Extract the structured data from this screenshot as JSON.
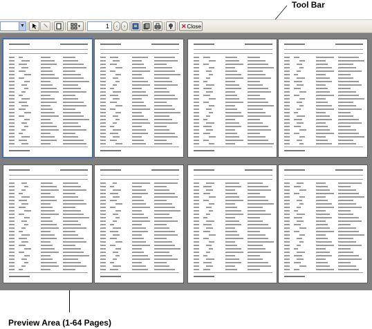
{
  "callouts": {
    "toolbar_label": "Tool Bar",
    "preview_label": "Preview Area (1-64 Pages)"
  },
  "toolbar": {
    "page_number": "1",
    "close_label": "Close",
    "icons": [
      "zoom-dropdown",
      "select-tool-icon",
      "hand-tool-icon",
      "single-page-icon",
      "multi-page-icon",
      "previous-page-icon",
      "next-page-icon",
      "page-setup-icon",
      "export-icon",
      "print-icon",
      "help-icon",
      "close-icon"
    ]
  },
  "preview": {
    "page_count": 8,
    "selected_page": 1
  }
}
